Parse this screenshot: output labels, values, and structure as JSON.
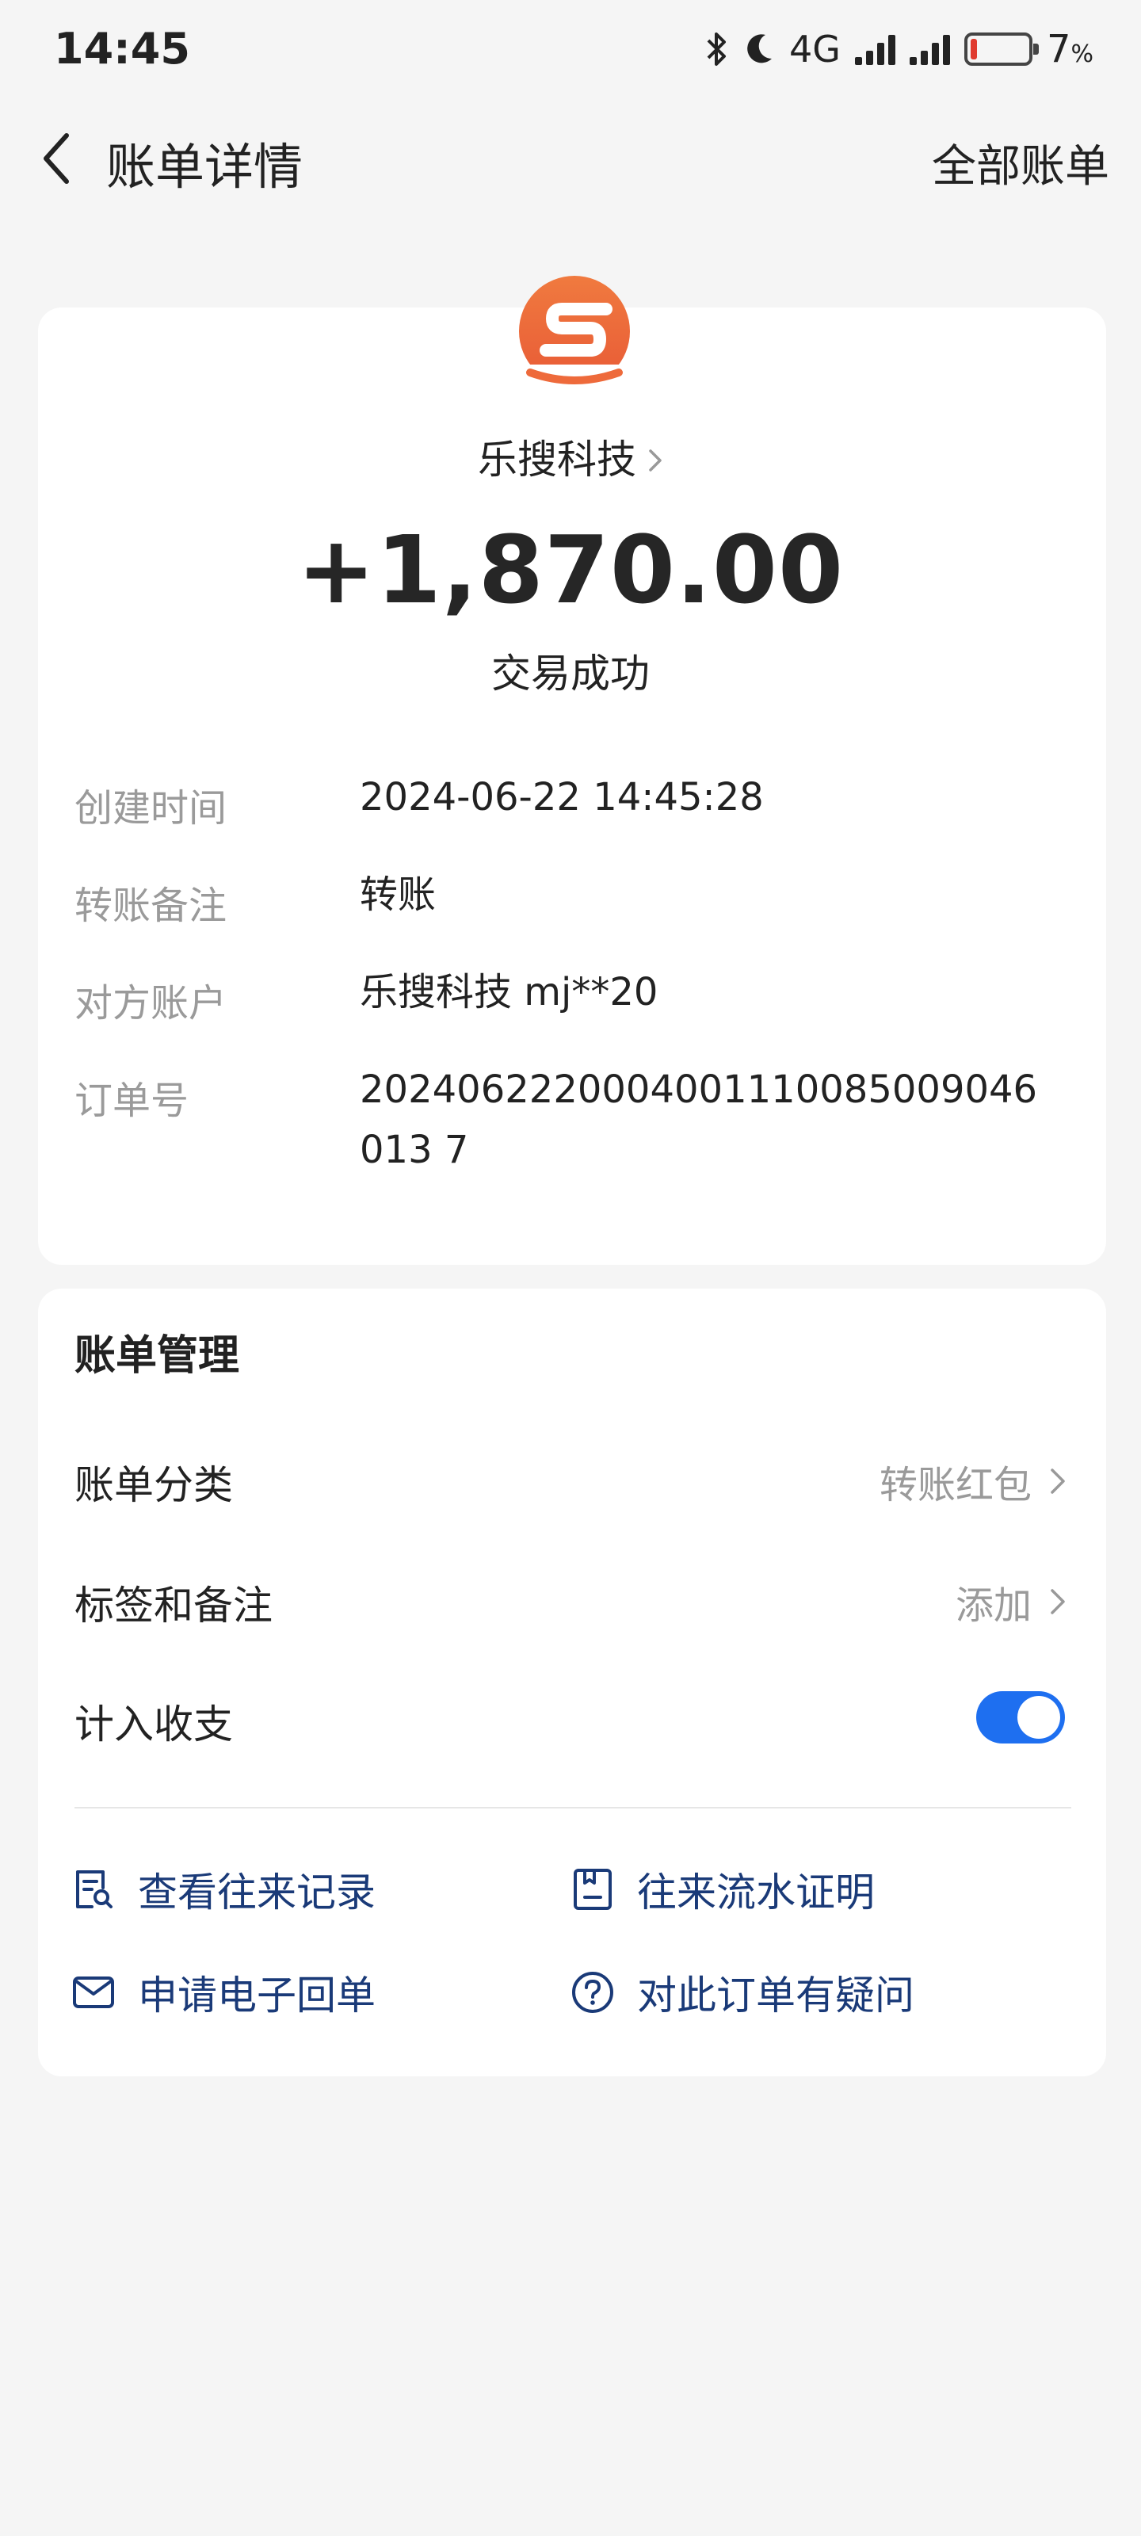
{
  "status_bar": {
    "time": "14:45",
    "network": "4G",
    "battery_text": "7",
    "battery_unit": "%"
  },
  "header": {
    "title": "账单详情",
    "right_link": "全部账单"
  },
  "transaction": {
    "merchant": "乐搜科技",
    "amount": "+1,870.00",
    "status": "交易成功",
    "details": [
      {
        "label": "创建时间",
        "value": "2024-06-22 14:45:28"
      },
      {
        "label": "转账备注",
        "value": "转账"
      },
      {
        "label": "对方账户",
        "value": "乐搜科技 mj**20"
      },
      {
        "label": "订单号",
        "value": "2024062220004001110085009046013 7"
      }
    ]
  },
  "management": {
    "title": "账单管理",
    "category_label": "账单分类",
    "category_value": "转账红包",
    "tags_label": "标签和备注",
    "tags_value": "添加",
    "include_label": "计入收支",
    "include_enabled": true,
    "actions": [
      {
        "label": "查看往来记录",
        "icon": "record-search-icon"
      },
      {
        "label": "往来流水证明",
        "icon": "statement-proof-icon"
      },
      {
        "label": "申请电子回单",
        "icon": "mail-icon"
      },
      {
        "label": "对此订单有疑问",
        "icon": "question-icon"
      }
    ]
  },
  "colors": {
    "background": "#f5f5f5",
    "accent": "#1e6ff0",
    "action_text": "#1a3a78",
    "logo_orange": "#ee6a3b",
    "battery_low": "#e03b2f"
  }
}
